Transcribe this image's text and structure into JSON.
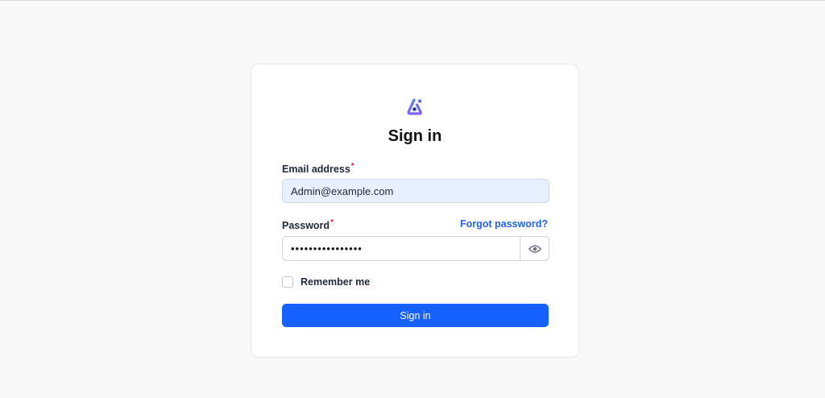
{
  "form": {
    "title": "Sign in",
    "email": {
      "label": "Email address",
      "required_mark": "*",
      "value": "Admin@example.com"
    },
    "password": {
      "label": "Password",
      "required_mark": "*",
      "value": "••••••••••••••••",
      "forgot_label": "Forgot password?",
      "toggle_icon": "eye-icon"
    },
    "remember": {
      "label": "Remember me",
      "checked": false
    },
    "submit_label": "Sign in"
  },
  "colors": {
    "primary": "#1660fb",
    "link": "#2563eb",
    "required": "#e11d48",
    "autofill_bg": "#e8f0fe"
  }
}
